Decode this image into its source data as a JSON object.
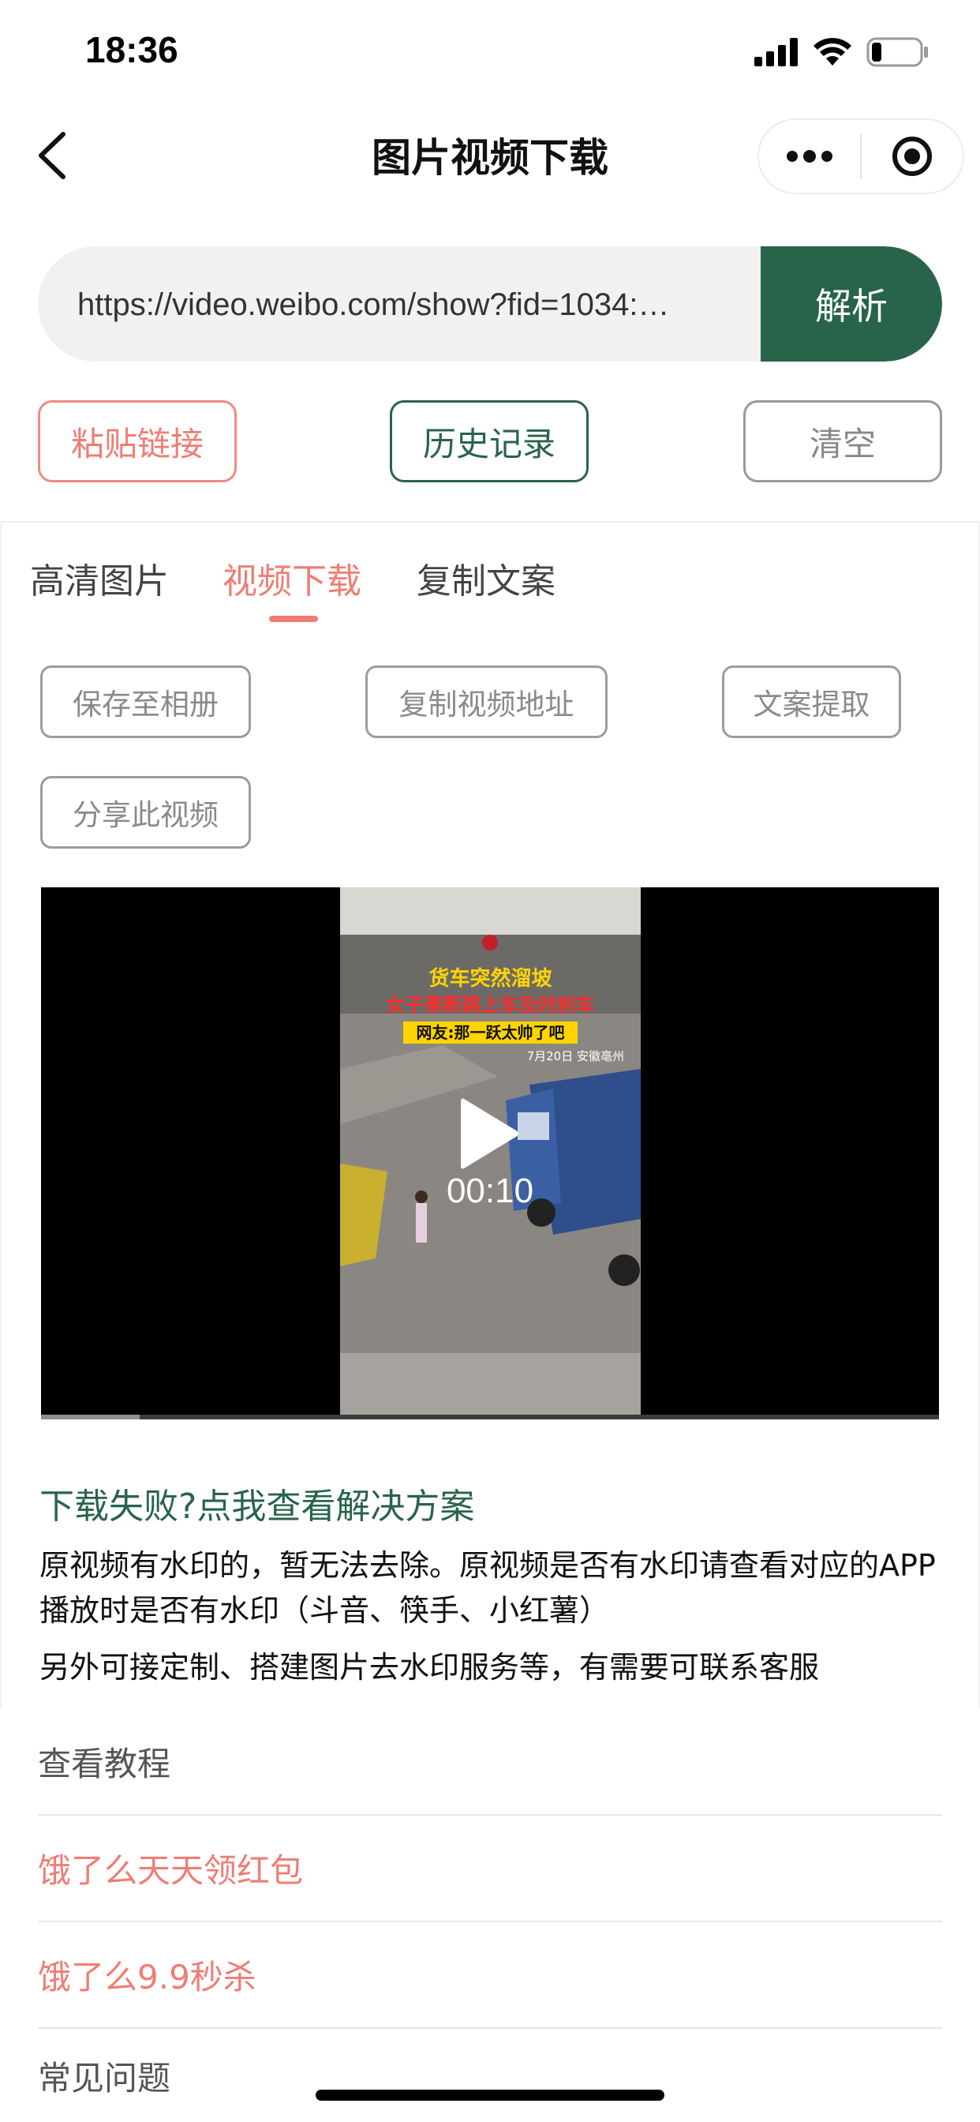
{
  "status_bar": {
    "time": "18:36",
    "icons": [
      "signal-icon",
      "wifi-icon",
      "battery-icon"
    ],
    "battery_level": 0.15
  },
  "nav": {
    "title": "图片视频下载",
    "back_icon": "chevron-left-icon",
    "capsule_icons": [
      "more-icon",
      "target-icon"
    ]
  },
  "url_bar": {
    "value": "https://video.weibo.com/show?fid=1034:…",
    "parse_label": "解析"
  },
  "actions": {
    "paste_label": "粘贴链接",
    "history_label": "历史记录",
    "clear_label": "清空"
  },
  "tabs": {
    "items": [
      {
        "label": "高清图片",
        "active": false
      },
      {
        "label": "视频下载",
        "active": true
      },
      {
        "label": "复制文案",
        "active": false
      }
    ]
  },
  "video_actions": {
    "save_label": "保存至相册",
    "copy_url_label": "复制视频地址",
    "extract_text_label": "文案提取",
    "share_label": "分享此视频"
  },
  "video": {
    "duration": "00:10",
    "progress": 0.11,
    "caption_line1": "货车突然溜坡",
    "caption_line2": "女子果断跳上车及时刹车",
    "caption_line3": "网友:那一跃太帅了吧",
    "caption_date": "7月20日 安徽亳州",
    "play_icon": "play-icon"
  },
  "help": {
    "fail_link": "下载失败?点我查看解决方案",
    "note1": "原视频有水印的，暂无法去除。原视频是否有水印请查看对应的APP播放时是否有水印（斗音、筷手、小红薯）",
    "note2": "另外可接定制、搭建图片去水印服务等，有需要可联系客服"
  },
  "list": {
    "tutorial": "查看教程",
    "eleme_red": "饿了么天天领红包",
    "eleme_99": "饿了么9.9秒杀",
    "faq": "常见问题"
  },
  "colors": {
    "brand_green": "#28644a",
    "accent_red": "#ef7d74"
  }
}
